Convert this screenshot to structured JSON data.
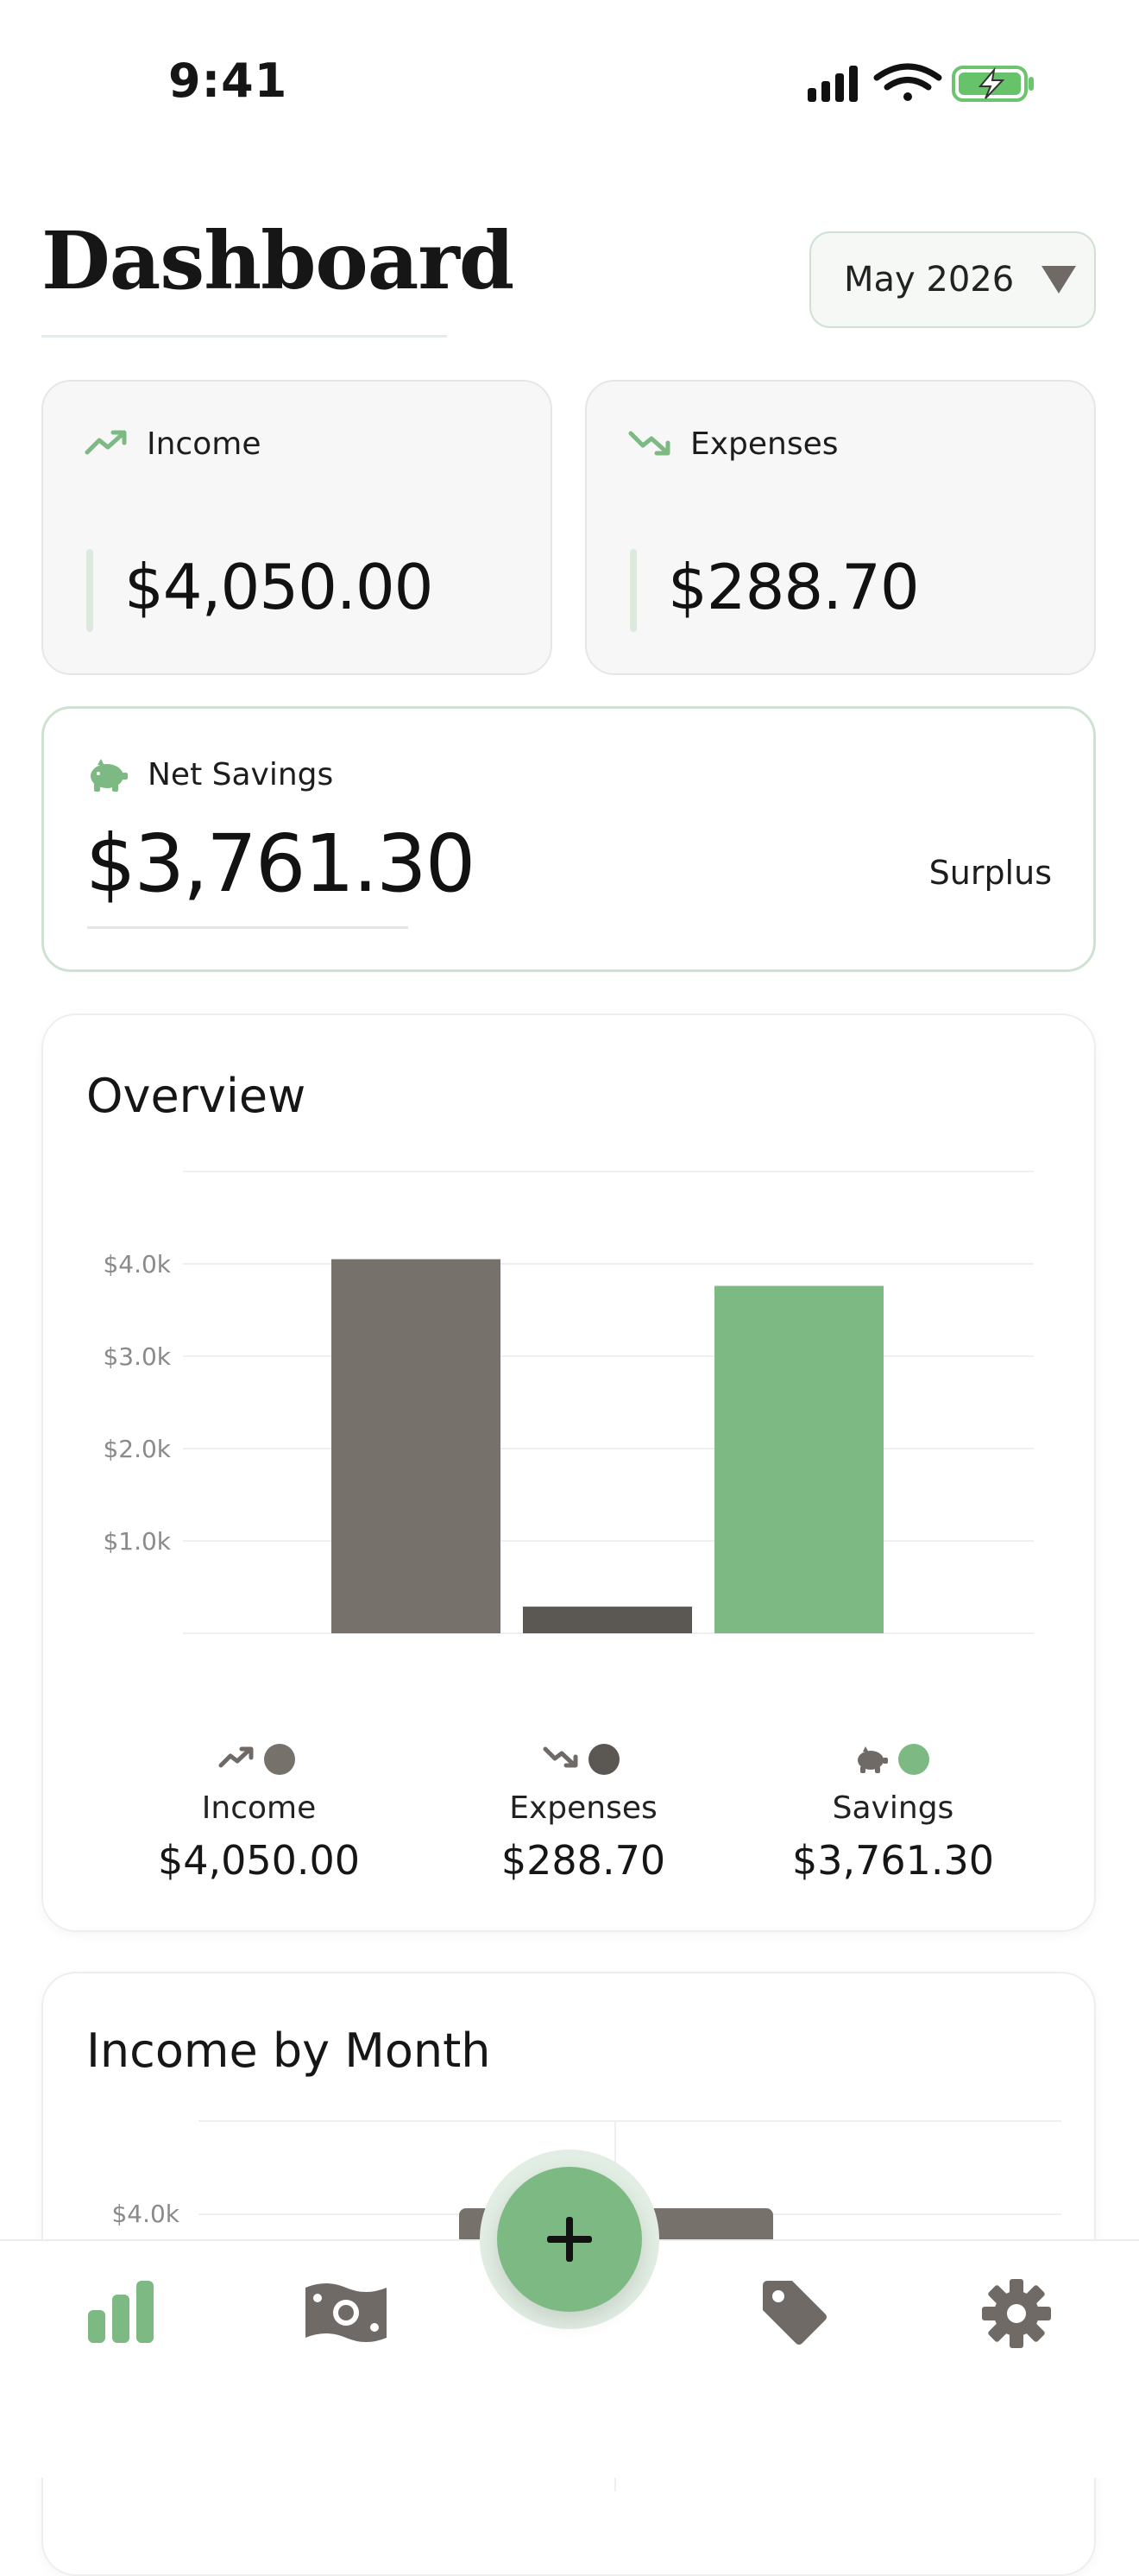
{
  "status_bar": {
    "time": "9:41"
  },
  "header": {
    "title": "Dashboard",
    "month_selector": "May 2026"
  },
  "cards": {
    "income": {
      "label": "Income",
      "amount": "$4,050.00"
    },
    "expenses": {
      "label": "Expenses",
      "amount": "$288.70"
    },
    "net_savings": {
      "label": "Net Savings",
      "amount": "$3,761.30",
      "status": "Surplus"
    }
  },
  "overview": {
    "title": "Overview",
    "legend": [
      {
        "label": "Income",
        "value": "$4,050.00",
        "icon": "trending-up-icon",
        "color": "#77716c"
      },
      {
        "label": "Expenses",
        "value": "$288.70",
        "icon": "trending-down-icon",
        "color": "#5b5854"
      },
      {
        "label": "Savings",
        "value": "$3,761.30",
        "icon": "piggy-bank-icon",
        "color": "#7db983"
      }
    ]
  },
  "income_by_month": {
    "title": "Income by Month",
    "first_tick": "$4.0k"
  },
  "colors": {
    "accent": "#7db983",
    "bar_gray": "#77716c",
    "bar_dark": "#5b5854"
  },
  "tabbar": {
    "items": [
      {
        "icon": "bar-chart-icon"
      },
      {
        "icon": "money-bill-icon"
      },
      {
        "icon": "plus-icon"
      },
      {
        "icon": "tag-icon"
      },
      {
        "icon": "gear-icon"
      }
    ]
  },
  "chart_data": {
    "type": "bar",
    "categories": [
      "Income",
      "Expenses",
      "Savings"
    ],
    "values": [
      4050.0,
      288.7,
      3761.3
    ],
    "ylim": [
      0,
      5000
    ],
    "yticks": [
      "$1.0k",
      "$2.0k",
      "$3.0k",
      "$4.0k"
    ],
    "grid": true,
    "legend_placement": "bottom"
  }
}
